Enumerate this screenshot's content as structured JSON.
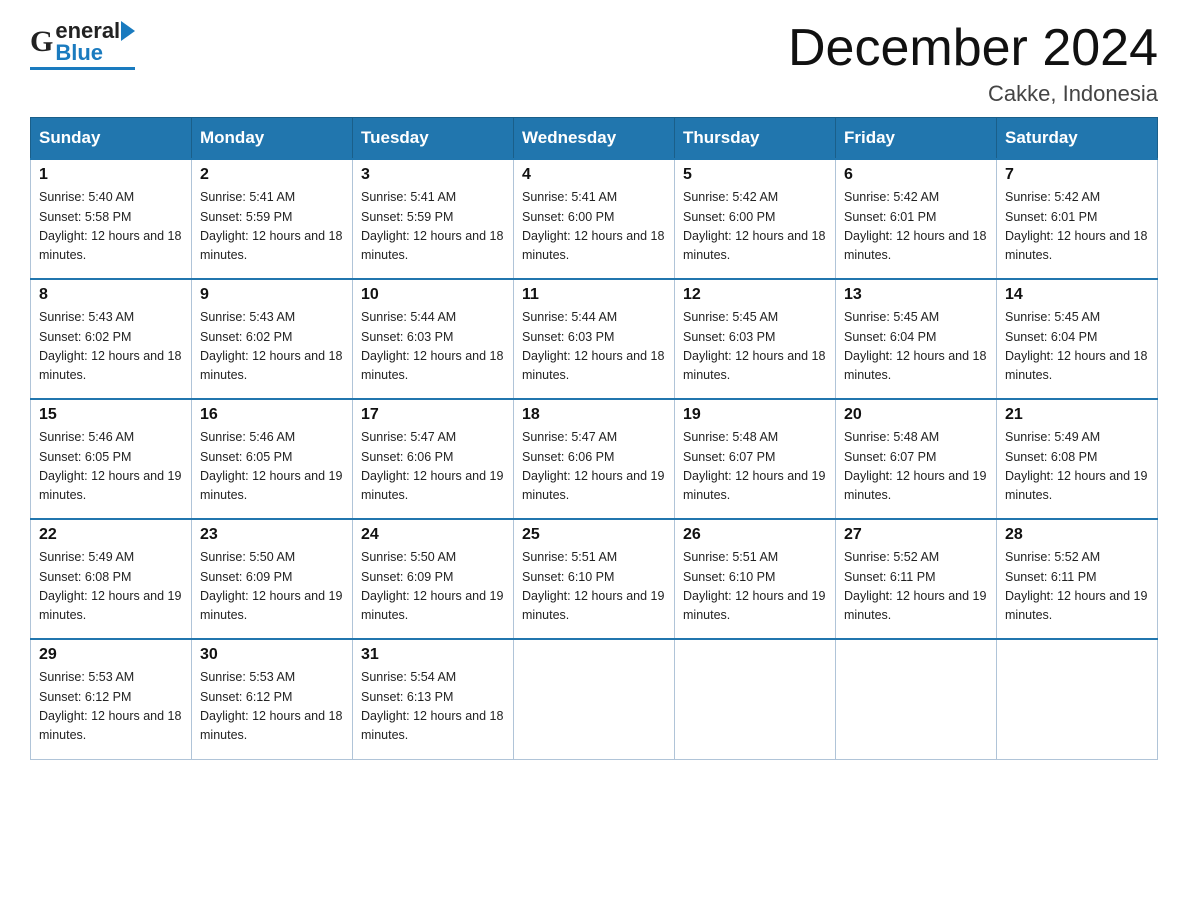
{
  "header": {
    "logo_general": "General",
    "logo_blue": "Blue",
    "month_title": "December 2024",
    "location": "Cakke, Indonesia"
  },
  "weekdays": [
    "Sunday",
    "Monday",
    "Tuesday",
    "Wednesday",
    "Thursday",
    "Friday",
    "Saturday"
  ],
  "weeks": [
    [
      {
        "day": "1",
        "sunrise": "5:40 AM",
        "sunset": "5:58 PM",
        "daylight": "12 hours and 18 minutes."
      },
      {
        "day": "2",
        "sunrise": "5:41 AM",
        "sunset": "5:59 PM",
        "daylight": "12 hours and 18 minutes."
      },
      {
        "day": "3",
        "sunrise": "5:41 AM",
        "sunset": "5:59 PM",
        "daylight": "12 hours and 18 minutes."
      },
      {
        "day": "4",
        "sunrise": "5:41 AM",
        "sunset": "6:00 PM",
        "daylight": "12 hours and 18 minutes."
      },
      {
        "day": "5",
        "sunrise": "5:42 AM",
        "sunset": "6:00 PM",
        "daylight": "12 hours and 18 minutes."
      },
      {
        "day": "6",
        "sunrise": "5:42 AM",
        "sunset": "6:01 PM",
        "daylight": "12 hours and 18 minutes."
      },
      {
        "day": "7",
        "sunrise": "5:42 AM",
        "sunset": "6:01 PM",
        "daylight": "12 hours and 18 minutes."
      }
    ],
    [
      {
        "day": "8",
        "sunrise": "5:43 AM",
        "sunset": "6:02 PM",
        "daylight": "12 hours and 18 minutes."
      },
      {
        "day": "9",
        "sunrise": "5:43 AM",
        "sunset": "6:02 PM",
        "daylight": "12 hours and 18 minutes."
      },
      {
        "day": "10",
        "sunrise": "5:44 AM",
        "sunset": "6:03 PM",
        "daylight": "12 hours and 18 minutes."
      },
      {
        "day": "11",
        "sunrise": "5:44 AM",
        "sunset": "6:03 PM",
        "daylight": "12 hours and 18 minutes."
      },
      {
        "day": "12",
        "sunrise": "5:45 AM",
        "sunset": "6:03 PM",
        "daylight": "12 hours and 18 minutes."
      },
      {
        "day": "13",
        "sunrise": "5:45 AM",
        "sunset": "6:04 PM",
        "daylight": "12 hours and 18 minutes."
      },
      {
        "day": "14",
        "sunrise": "5:45 AM",
        "sunset": "6:04 PM",
        "daylight": "12 hours and 18 minutes."
      }
    ],
    [
      {
        "day": "15",
        "sunrise": "5:46 AM",
        "sunset": "6:05 PM",
        "daylight": "12 hours and 19 minutes."
      },
      {
        "day": "16",
        "sunrise": "5:46 AM",
        "sunset": "6:05 PM",
        "daylight": "12 hours and 19 minutes."
      },
      {
        "day": "17",
        "sunrise": "5:47 AM",
        "sunset": "6:06 PM",
        "daylight": "12 hours and 19 minutes."
      },
      {
        "day": "18",
        "sunrise": "5:47 AM",
        "sunset": "6:06 PM",
        "daylight": "12 hours and 19 minutes."
      },
      {
        "day": "19",
        "sunrise": "5:48 AM",
        "sunset": "6:07 PM",
        "daylight": "12 hours and 19 minutes."
      },
      {
        "day": "20",
        "sunrise": "5:48 AM",
        "sunset": "6:07 PM",
        "daylight": "12 hours and 19 minutes."
      },
      {
        "day": "21",
        "sunrise": "5:49 AM",
        "sunset": "6:08 PM",
        "daylight": "12 hours and 19 minutes."
      }
    ],
    [
      {
        "day": "22",
        "sunrise": "5:49 AM",
        "sunset": "6:08 PM",
        "daylight": "12 hours and 19 minutes."
      },
      {
        "day": "23",
        "sunrise": "5:50 AM",
        "sunset": "6:09 PM",
        "daylight": "12 hours and 19 minutes."
      },
      {
        "day": "24",
        "sunrise": "5:50 AM",
        "sunset": "6:09 PM",
        "daylight": "12 hours and 19 minutes."
      },
      {
        "day": "25",
        "sunrise": "5:51 AM",
        "sunset": "6:10 PM",
        "daylight": "12 hours and 19 minutes."
      },
      {
        "day": "26",
        "sunrise": "5:51 AM",
        "sunset": "6:10 PM",
        "daylight": "12 hours and 19 minutes."
      },
      {
        "day": "27",
        "sunrise": "5:52 AM",
        "sunset": "6:11 PM",
        "daylight": "12 hours and 19 minutes."
      },
      {
        "day": "28",
        "sunrise": "5:52 AM",
        "sunset": "6:11 PM",
        "daylight": "12 hours and 19 minutes."
      }
    ],
    [
      {
        "day": "29",
        "sunrise": "5:53 AM",
        "sunset": "6:12 PM",
        "daylight": "12 hours and 18 minutes."
      },
      {
        "day": "30",
        "sunrise": "5:53 AM",
        "sunset": "6:12 PM",
        "daylight": "12 hours and 18 minutes."
      },
      {
        "day": "31",
        "sunrise": "5:54 AM",
        "sunset": "6:13 PM",
        "daylight": "12 hours and 18 minutes."
      },
      null,
      null,
      null,
      null
    ]
  ]
}
